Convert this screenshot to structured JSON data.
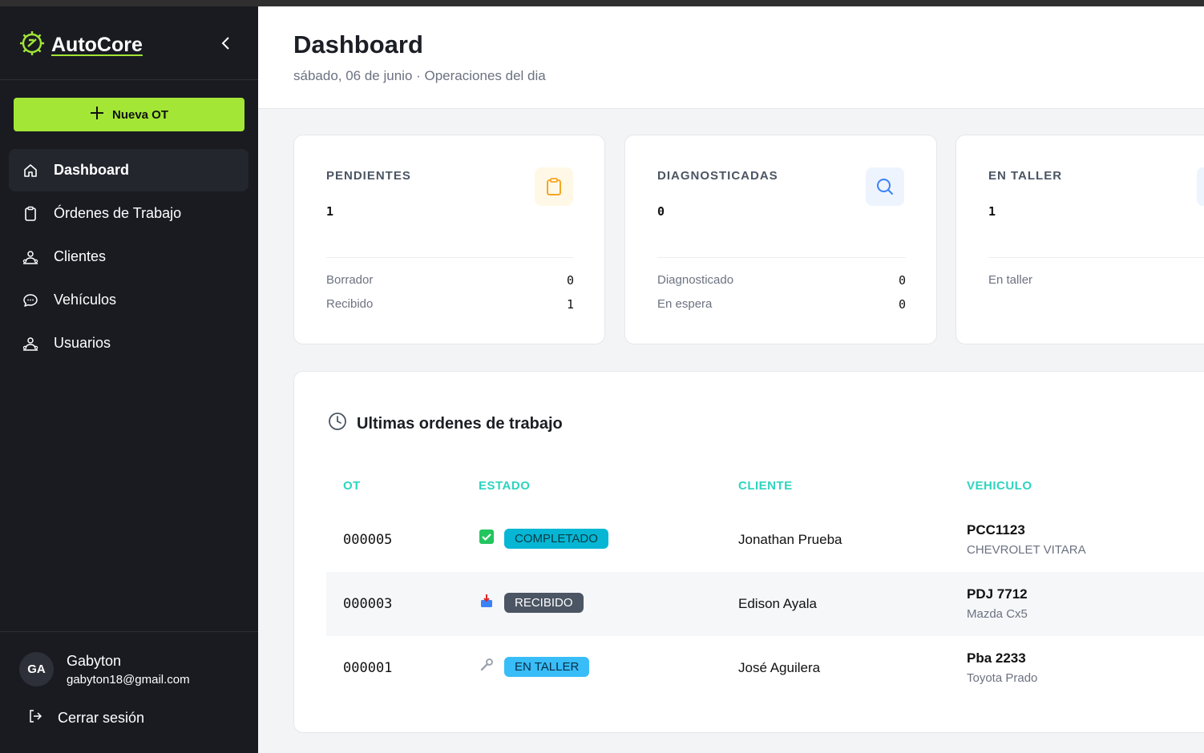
{
  "sidebar": {
    "brand": "AutoCore",
    "new_button": "Nueva OT",
    "nav": [
      {
        "label": "Dashboard",
        "icon": "home-icon"
      },
      {
        "label": "Órdenes de Trabajo",
        "icon": "clipboard-icon"
      },
      {
        "label": "Clientes",
        "icon": "users-icon"
      },
      {
        "label": "Vehículos",
        "icon": "chat-icon"
      },
      {
        "label": "Usuarios",
        "icon": "users-icon"
      }
    ],
    "user": {
      "initials": "GA",
      "name": "Gabyton",
      "email": "gabyton18@gmail.com"
    },
    "logout": "Cerrar sesión"
  },
  "header": {
    "title": "Dashboard",
    "subtitle": "sábado, 06 de junio · Operaciones del dia"
  },
  "cards": [
    {
      "label": "PENDIENTES",
      "count": "1",
      "icon": "clipboard-icon",
      "icon_color": "#f5a623",
      "icon_bg": "#fff8e6",
      "rows": [
        {
          "label": "Borrador",
          "value": "0"
        },
        {
          "label": "Recibido",
          "value": "1"
        }
      ]
    },
    {
      "label": "DIAGNOSTICADAS",
      "count": "0",
      "icon": "search-icon",
      "icon_color": "#3b82f6",
      "icon_bg": "#eef4fe",
      "rows": [
        {
          "label": "Diagnosticado",
          "value": "0"
        },
        {
          "label": "En espera",
          "value": "0"
        }
      ]
    },
    {
      "label": "EN TALLER",
      "count": "1",
      "icon": "wrench-icon",
      "icon_color": "#3b82f6",
      "icon_bg": "#eef4fe",
      "rows": [
        {
          "label": "En taller",
          "value": ""
        }
      ]
    }
  ],
  "orders": {
    "title": "Ultimas ordenes de trabajo",
    "columns": [
      "OT",
      "ESTADO",
      "CLIENTE",
      "VEHICULO"
    ],
    "rows": [
      {
        "ot": "000005",
        "estado": "COMPLETADO",
        "estado_icon": "check-icon",
        "badge_bg": "#06b6d4",
        "badge_fg": "#0b3b44",
        "cliente": "Jonathan Prueba",
        "placa": "PCC1123",
        "modelo": "CHEVROLET VITARA"
      },
      {
        "ot": "000003",
        "estado": "RECIBIDO",
        "estado_icon": "inbox-icon",
        "badge_bg": "#4b5563",
        "badge_fg": "#ffffff",
        "cliente": "Edison Ayala",
        "placa": "PDJ 7712",
        "modelo": "Mazda Cx5"
      },
      {
        "ot": "000001",
        "estado": "EN TALLER",
        "estado_icon": "wrench-icon",
        "badge_bg": "#38bdf8",
        "badge_fg": "#0b2d44",
        "cliente": "José Aguilera",
        "placa": "Pba 2233",
        "modelo": "Toyota Prado"
      }
    ]
  },
  "colors": {
    "accent": "#a3e635",
    "sidebar_bg": "#191b21",
    "table_header": "#2dd4bf"
  }
}
